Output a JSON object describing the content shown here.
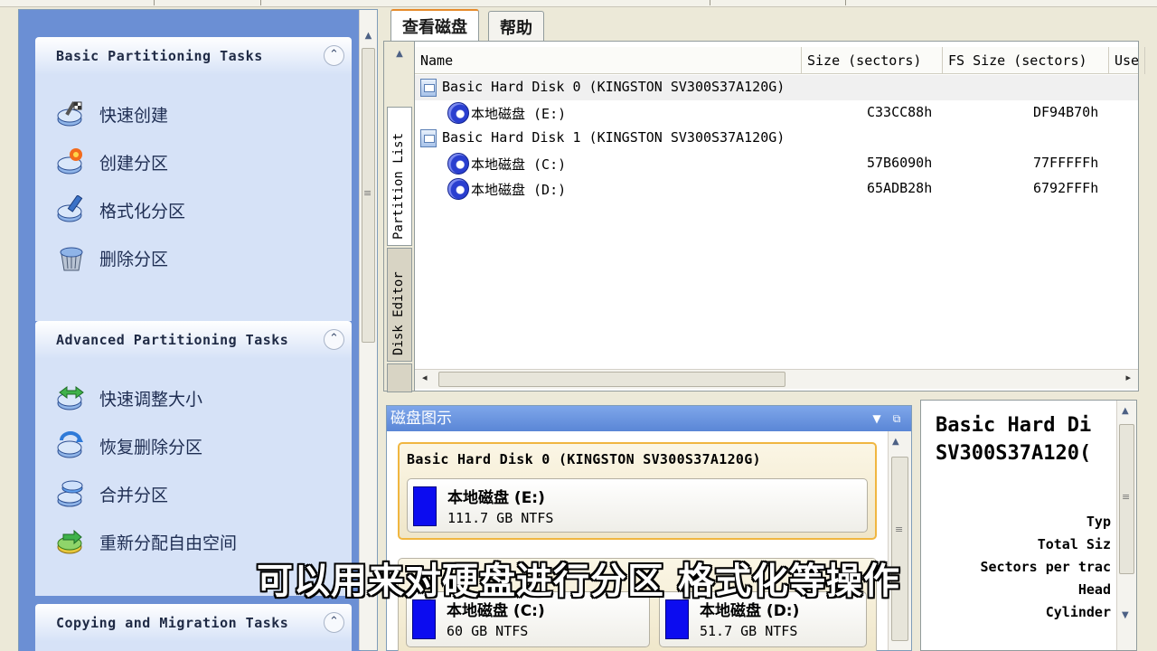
{
  "left_panel": {
    "groups": [
      {
        "title": "Basic Partitioning Tasks",
        "tasks": [
          {
            "label": "快速创建",
            "icon": "disk-wand-icon"
          },
          {
            "label": "创建分区",
            "icon": "disk-create-icon"
          },
          {
            "label": "格式化分区",
            "icon": "disk-format-icon"
          },
          {
            "label": "删除分区",
            "icon": "disk-delete-icon"
          }
        ]
      },
      {
        "title": "Advanced Partitioning Tasks",
        "tasks": [
          {
            "label": "快速调整大小",
            "icon": "disk-resize-icon"
          },
          {
            "label": "恢复删除分区",
            "icon": "disk-recover-icon"
          },
          {
            "label": "合并分区",
            "icon": "disk-merge-icon"
          },
          {
            "label": "重新分配自由空间",
            "icon": "disk-reallocate-icon"
          }
        ]
      },
      {
        "title": "Copying and Migration Tasks",
        "tasks": []
      }
    ]
  },
  "tabs": [
    "查看磁盘",
    "帮助"
  ],
  "vertical_tabs": [
    "Partition List",
    "Disk Editor"
  ],
  "table": {
    "columns": [
      "Name",
      "Size (sectors)",
      "FS Size (sectors)",
      "Use"
    ],
    "rows": [
      {
        "type": "disk",
        "name": "Basic Hard Disk 0  (KINGSTON SV300S37A120G)",
        "size": "",
        "fs_size": ""
      },
      {
        "type": "partition",
        "name": "本地磁盘  (E:)",
        "size": "C33CC88h",
        "fs_size": "DF94B70h"
      },
      {
        "type": "disk",
        "name": "Basic Hard Disk 1  (KINGSTON SV300S37A120G)",
        "size": "",
        "fs_size": ""
      },
      {
        "type": "partition",
        "name": "本地磁盘  (C:)",
        "size": "57B6090h",
        "fs_size": "77FFFFFh"
      },
      {
        "type": "partition",
        "name": "本地磁盘  (D:)",
        "size": "65ADB28h",
        "fs_size": "6792FFFh"
      }
    ]
  },
  "disk_map": {
    "title": "磁盘图示",
    "disks": [
      {
        "title": "Basic Hard Disk 0  (KINGSTON SV300S37A120G)",
        "partitions": [
          {
            "name": "本地磁盘  (E:)",
            "size": "111.7 GB NTFS"
          }
        ]
      },
      {
        "title": "",
        "partitions": [
          {
            "name": "本地磁盘  (C:)",
            "size": "60 GB NTFS"
          },
          {
            "name": "本地磁盘  (D:)",
            "size": "51.7 GB NTFS"
          }
        ]
      }
    ]
  },
  "info": {
    "title_line1": "Basic Hard Di",
    "title_line2": "SV300S37A120(",
    "labels": [
      "Typ",
      "Total Siz",
      "Sectors per trac",
      "Head",
      "Cylinder"
    ]
  },
  "caption": "可以用来对硬盘进行分区 格式化等操作",
  "colors": {
    "panel_bg": "#6b8fd4",
    "group_bg": "#d6e2f7",
    "accent_orange": "#e68b2c",
    "partition_blue": "#0c0cf0"
  }
}
